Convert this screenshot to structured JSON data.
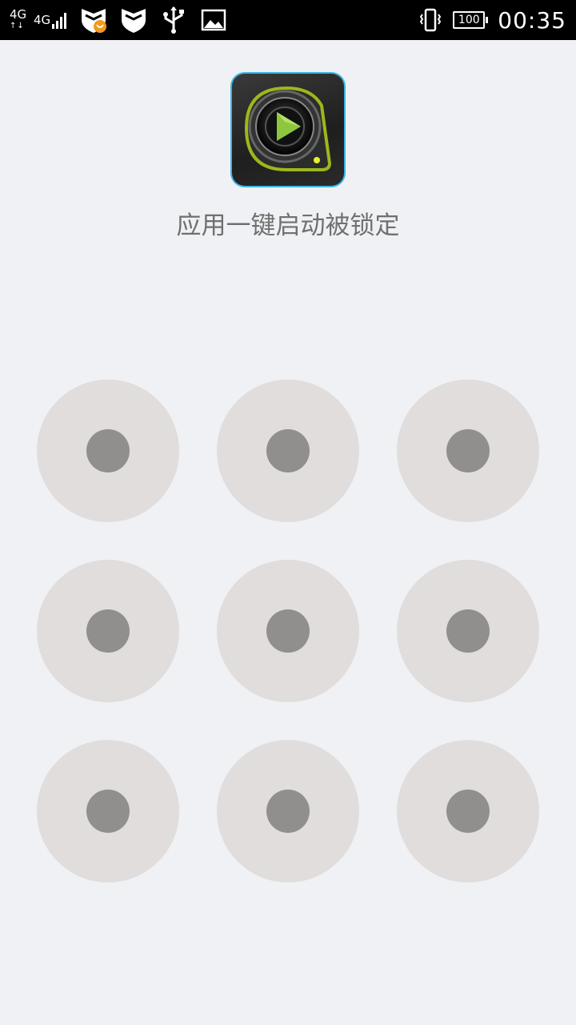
{
  "status_bar": {
    "network_left": "4G",
    "network_right": "4G",
    "battery_percent": "100",
    "time": "00:35",
    "icons": [
      "signal-icon",
      "shield-call-icon",
      "shield-icon",
      "usb-icon",
      "image-icon",
      "vibrate-icon",
      "battery-icon"
    ]
  },
  "lock_screen": {
    "app_icon": "video-player-icon",
    "title": "应用一键启动被锁定",
    "pattern": {
      "rows": 3,
      "cols": 3,
      "nodes": [
        1,
        2,
        3,
        4,
        5,
        6,
        7,
        8,
        9
      ]
    }
  },
  "colors": {
    "background": "#eff1f4",
    "node_outer": "#e0dddc",
    "node_inner": "#908f8d",
    "icon_accent": "#8dc63f"
  }
}
